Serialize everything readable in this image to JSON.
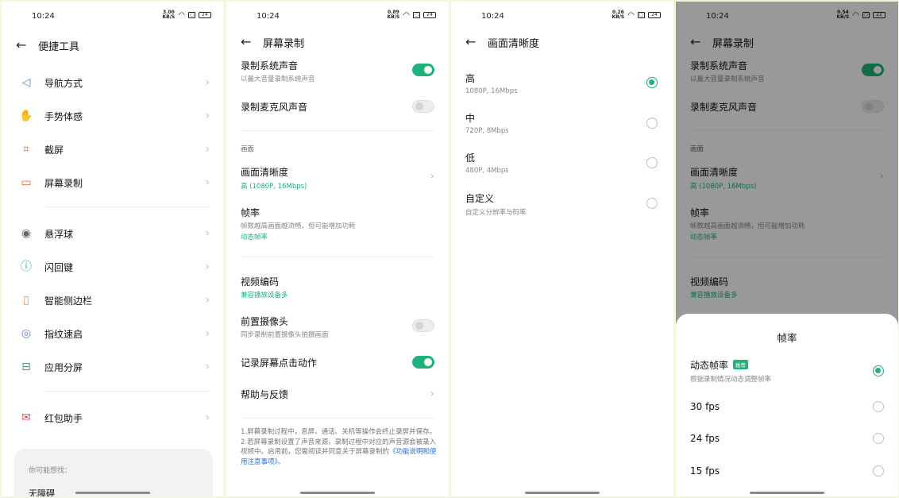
{
  "screen1": {
    "status": {
      "time": "10:24",
      "speed_value": "3.00",
      "speed_unit": "KB/S",
      "battery": "24"
    },
    "title": "便捷工具",
    "items": [
      {
        "label": "导航方式",
        "icon": "navigation-triangle-icon"
      },
      {
        "label": "手势体感",
        "icon": "hand-gesture-icon"
      },
      {
        "label": "截屏",
        "icon": "crop-icon"
      },
      {
        "label": "屏幕录制",
        "icon": "video-record-icon"
      },
      {
        "label": "悬浮球",
        "icon": "floating-ball-icon"
      },
      {
        "label": "闪回键",
        "icon": "lightning-icon"
      },
      {
        "label": "智能侧边栏",
        "icon": "sidebar-icon"
      },
      {
        "label": "指纹速启",
        "icon": "fingerprint-icon"
      },
      {
        "label": "应用分屏",
        "icon": "split-screen-icon"
      },
      {
        "label": "红包助手",
        "icon": "red-packet-icon"
      }
    ],
    "suggest_title": "你可能想找：",
    "suggest_item": "无障碍"
  },
  "screen2": {
    "status": {
      "time": "10:24",
      "speed_value": "0.89",
      "speed_unit": "KB/S",
      "battery": "24"
    },
    "title": "屏幕录制",
    "system_audio": {
      "label": "录制系统声音",
      "sub": "以最大音量录制系统声音",
      "on": true
    },
    "mic_audio": {
      "label": "录制麦克风声音",
      "on": false
    },
    "section_picture": "画面",
    "clarity": {
      "label": "画面清晰度",
      "value": "高 (1080P, 16Mbps)"
    },
    "framerate": {
      "label": "帧率",
      "sub": "帧数越高画面越流畅，但可能增加功耗",
      "value": "动态帧率"
    },
    "codec": {
      "label": "视频编码",
      "value": "兼容播放设备多"
    },
    "front_camera": {
      "label": "前置摄像头",
      "sub": "同步录制前置摄像头拍摄画面",
      "on": false
    },
    "record_taps": {
      "label": "记录屏幕点击动作",
      "on": true
    },
    "help": {
      "label": "帮助与反馈"
    },
    "notes": {
      "line1": "1.屏幕录制过程中，息屏、通话、关机等操作会终止录屏并保存。",
      "line2": "2.若屏幕录制设置了声音来源，录制过程中对应的声音源会被录入视频中。启用前，您需阅读并同意关于屏幕录制的",
      "link": "《功能说明和使用注意事项》",
      "tail": "。"
    }
  },
  "screen3": {
    "status": {
      "time": "10:24",
      "speed_value": "0.26",
      "speed_unit": "KB/S",
      "battery": "24"
    },
    "title": "画面清晰度",
    "options": [
      {
        "label": "高",
        "sub": "1080P, 16Mbps",
        "selected": true
      },
      {
        "label": "中",
        "sub": "720P, 8Mbps",
        "selected": false
      },
      {
        "label": "低",
        "sub": "480P, 4Mbps",
        "selected": false
      },
      {
        "label": "自定义",
        "sub": "自定义分辨率与码率",
        "selected": false
      }
    ]
  },
  "screen4": {
    "status": {
      "time": "10:24",
      "speed_value": "0.54",
      "speed_unit": "KB/S",
      "battery": "22"
    },
    "title": "屏幕录制",
    "sheet_title": "帧率",
    "options": [
      {
        "label": "动态帧率",
        "tag": "推荐",
        "sub": "根据录制情况动态调整帧率",
        "selected": true
      },
      {
        "label": "30 fps",
        "selected": false
      },
      {
        "label": "24 fps",
        "selected": false
      },
      {
        "label": "15 fps",
        "selected": false
      }
    ]
  },
  "colors": {
    "accent": "#1fb27a",
    "link": "#2a6fd8"
  }
}
